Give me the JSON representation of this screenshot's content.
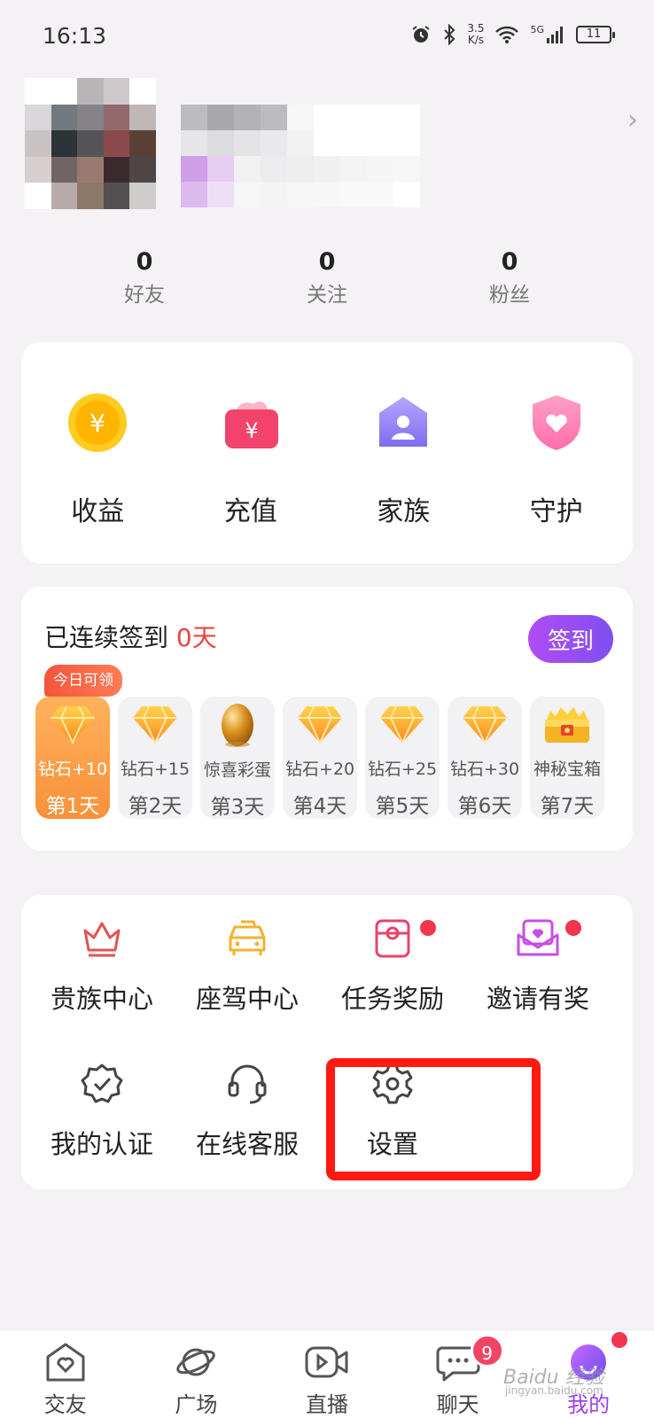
{
  "status_bar": {
    "time": "16:13",
    "net_speed": "3.5",
    "net_unit": "K/s",
    "network": "5G",
    "battery": "11"
  },
  "profile": {
    "avatar_pixels": [
      "#ffffff",
      "#ffffff",
      "#b9b6b8",
      "#cfc9cb",
      "#ffffff",
      "#d8d6d8",
      "#727a80",
      "#858288",
      "#93696c",
      "#bfb6b5",
      "#c9c3c4",
      "#2d3438",
      "#555557",
      "#8a4a4c",
      "#5a4136",
      "#d6cfcf",
      "#716563",
      "#9a7a70",
      "#3b2a2c",
      "#4d4645",
      "#ffffff",
      "#b7aaa9",
      "#8d7768",
      "#545052",
      "#cfcccc"
    ],
    "name_pixels": [
      "#bcbcbe",
      "#a9a9ab",
      "#b3b3b5",
      "#bcbcbe",
      "#f6f6f6",
      "#ffffff",
      "#ffffff",
      "#ffffff",
      "#ffffff",
      "#e6e6e8",
      "#dcdcde",
      "#e4e4e6",
      "#e9e9eb",
      "#f2f2f2",
      "#ffffff",
      "#ffffff",
      "#ffffff",
      "#ffffff",
      "#cf9ee8",
      "#e7cdf2",
      "#f1f1f2",
      "#ececee",
      "#eeeeef",
      "#f0f0f1",
      "#f3f3f4",
      "#f5f5f6",
      "#f6f6f7",
      "#ddb9ee",
      "#efdff6",
      "#f6f6f7",
      "#f4f4f5",
      "#f6f6f7",
      "#f7f7f8",
      "#f9f9fa",
      "#f8f8f9",
      "#ffffff"
    ]
  },
  "stats": [
    {
      "value": "0",
      "label": "好友"
    },
    {
      "value": "0",
      "label": "关注"
    },
    {
      "value": "0",
      "label": "粉丝"
    }
  ],
  "wallet": [
    {
      "label": "收益",
      "icon": "coin-icon"
    },
    {
      "label": "充值",
      "icon": "wallet-icon"
    },
    {
      "label": "家族",
      "icon": "family-icon"
    },
    {
      "label": "守护",
      "icon": "guard-shield-icon"
    }
  ],
  "checkin": {
    "title_prefix": "已连续签到",
    "days_count": "0天",
    "button": "签到",
    "today_tag": "今日可领",
    "days": [
      {
        "reward": "钻石+10",
        "day": "第1天",
        "icon": "diamond-icon"
      },
      {
        "reward": "钻石+15",
        "day": "第2天",
        "icon": "diamond-icon"
      },
      {
        "reward": "惊喜彩蛋",
        "day": "第3天",
        "icon": "golden-egg-icon"
      },
      {
        "reward": "钻石+20",
        "day": "第4天",
        "icon": "diamond-icon"
      },
      {
        "reward": "钻石+25",
        "day": "第5天",
        "icon": "diamond-icon"
      },
      {
        "reward": "钻石+30",
        "day": "第6天",
        "icon": "diamond-icon"
      },
      {
        "reward": "神秘宝箱",
        "day": "第7天",
        "icon": "treasure-chest-icon"
      }
    ]
  },
  "tools": [
    {
      "label": "贵族中心",
      "icon": "crown-icon"
    },
    {
      "label": "座驾中心",
      "icon": "car-icon"
    },
    {
      "label": "任务奖励",
      "icon": "task-reward-icon"
    },
    {
      "label": "邀请有奖",
      "icon": "invite-envelope-icon"
    },
    {
      "label": "我的认证",
      "icon": "verified-badge-icon"
    },
    {
      "label": "在线客服",
      "icon": "headset-icon"
    },
    {
      "label": "设置",
      "icon": "gear-icon"
    }
  ],
  "tabbar": [
    {
      "label": "交友",
      "icon": "heart-house-icon"
    },
    {
      "label": "广场",
      "icon": "planet-icon"
    },
    {
      "label": "直播",
      "icon": "video-camera-icon"
    },
    {
      "label": "聊天",
      "icon": "chat-bubble-icon",
      "badge": "9"
    },
    {
      "label": "我的",
      "icon": "me-avatar-icon"
    }
  ],
  "watermark": {
    "text": "Baidu 经验",
    "sub": "jingyan.baidu.com"
  },
  "colors": {
    "accent_purple": "#9b3ff0",
    "checkin_red": "#e8453c",
    "highlight_red": "#ff1a12",
    "badge_red": "#f04566"
  }
}
